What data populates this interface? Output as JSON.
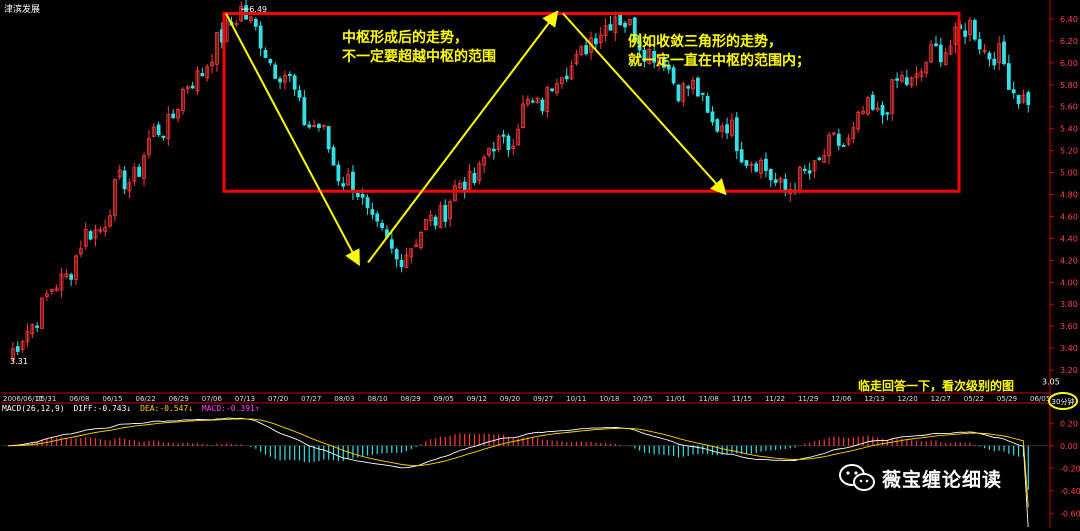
{
  "stock_name": "津滨发展",
  "annotations": {
    "center_left": [
      "中枢形成后的走势，",
      "不一定要超越中枢的范围"
    ],
    "center_right": [
      "例如收敛三角形的走势，",
      "就一定一直在中枢的范围内；"
    ],
    "bottom_right": "临走回答一下，看次级别的图"
  },
  "macd_legend": {
    "name": "MACD(26,12,9)",
    "diff": "DIFF:-0.743↓",
    "dea": "DEA:-0.547↓",
    "macd": "MACD:-0.391↑"
  },
  "period_badge": "30分钟",
  "watermark": "薇宝缠论细读",
  "colors": {
    "up": "#ff3a3a",
    "down": "#33e0e6",
    "box": "#ff0000",
    "arrow": "#ffff00",
    "axis": "#cc0000",
    "diff_line": "#ffffff",
    "dea_line": "#ffd400",
    "macd_label": "#ff40ff"
  },
  "chart_data": [
    {
      "type": "candlestick",
      "title": "津滨发展",
      "x_ticks": [
        "2006/06/11",
        "05/31",
        "06/08",
        "06/15",
        "06/22",
        "06/29",
        "07/06",
        "07/13",
        "07/20",
        "07/27",
        "08/03",
        "08/10",
        "08/29",
        "09/05",
        "09/12",
        "09/20",
        "09/27",
        "10/11",
        "10/18",
        "10/25",
        "11/01",
        "11/08",
        "11/15",
        "11/22",
        "11/29",
        "12/06",
        "12/13",
        "12/20",
        "12/27",
        "05/22",
        "05/29",
        "06/05"
      ],
      "y_ticks": [
        3.2,
        3.4,
        3.6,
        3.8,
        4.0,
        4.2,
        4.4,
        4.6,
        4.8,
        5.0,
        5.2,
        5.4,
        5.6,
        5.8,
        6.0,
        6.2,
        6.4
      ],
      "ylim": [
        3.0,
        6.5
      ],
      "labels": {
        "high": "6.49",
        "low": "3.31",
        "last": "3.05"
      },
      "pivots": [
        {
          "label": "start",
          "value": 3.31
        },
        {
          "label": "high",
          "value": 6.49
        },
        {
          "label": "low",
          "value": 4.2
        },
        {
          "label": "high",
          "value": 6.45
        },
        {
          "label": "low",
          "value": 4.82
        },
        {
          "label": "high",
          "value": 6.35
        },
        {
          "label": "end",
          "value": 5.62
        }
      ],
      "zhongshu_box": {
        "top": 6.45,
        "bottom": 4.83
      },
      "trend_arrows": [
        {
          "from": 6.45,
          "to": 4.18
        },
        {
          "from": 4.18,
          "to": 6.45
        },
        {
          "from": 6.45,
          "to": 4.82
        }
      ]
    },
    {
      "type": "bar",
      "title": "MACD(26,12,9)",
      "y_ticks": [
        0.2,
        0.0,
        -0.2,
        -0.4,
        -0.6
      ],
      "ylim": [
        -0.66,
        0.3
      ],
      "series": [
        {
          "name": "DIFF",
          "last": -0.743
        },
        {
          "name": "DEA",
          "last": -0.547
        },
        {
          "name": "MACD",
          "last": -0.391
        }
      ]
    }
  ]
}
